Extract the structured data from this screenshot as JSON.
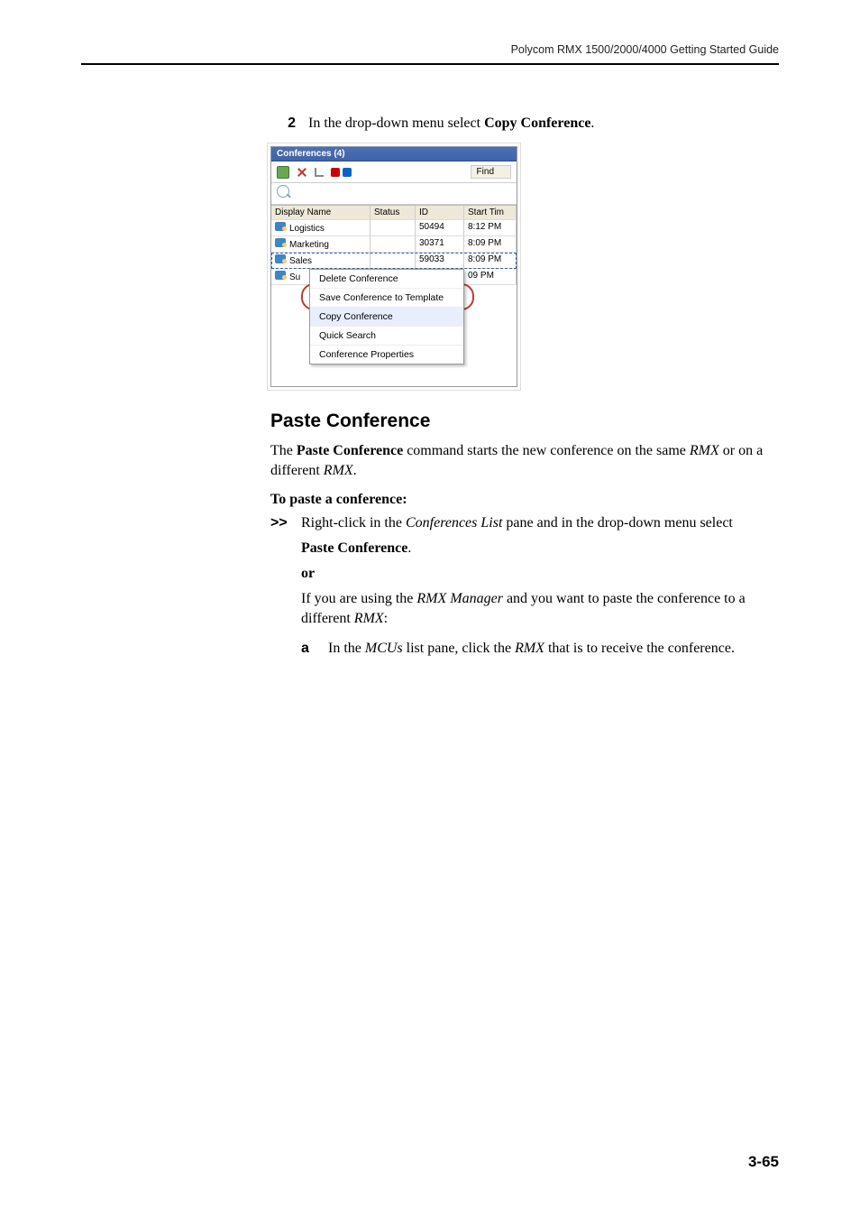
{
  "running_head": "Polycom RMX 1500/2000/4000 Getting Started Guide",
  "step2": {
    "num": "2",
    "text_pre": "In the drop-down menu select ",
    "text_bold": "Copy Conference",
    "text_post": "."
  },
  "shot": {
    "title": "Conferences (4)",
    "find_label": "Find",
    "headers": {
      "name": "Display Name",
      "status": "Status",
      "id": "ID",
      "start": "Start Tim"
    },
    "rows": [
      {
        "name": "Logistics",
        "id": "50494",
        "start": "8:12 PM"
      },
      {
        "name": "Marketing",
        "id": "30371",
        "start": "8:09 PM"
      },
      {
        "name": "Sales",
        "id": "59033",
        "start": "8:09 PM"
      },
      {
        "name": "Su",
        "id": "",
        "start": "09 PM"
      }
    ],
    "menu": {
      "delete": "Delete Conference",
      "save_tpl": "Save Conference to Template",
      "copy": "Copy Conference",
      "quick": "Quick Search",
      "props": "Conference Properties"
    }
  },
  "section_title": "Paste Conference",
  "para1": {
    "pre": "The ",
    "b1": "Paste Conference",
    "mid": " command starts the new conference on the same ",
    "i1": "RMX",
    "mid2": " or on a different ",
    "i2": "RMX",
    "post": "."
  },
  "subhead": "To paste a conference:",
  "angle_step": {
    "chev": ">>",
    "pre": "Right-click in the ",
    "i1": "Conferences List",
    "mid": " pane and in the drop-down menu select",
    "b1": "Paste Conference",
    "post": ".",
    "or": "or",
    "rmx_mgr_pre": "If you are using the ",
    "rmx_mgr_i": "RMX Manager",
    "rmx_mgr_mid": " and you want to paste the conference to a different ",
    "rmx_mgr_i2": "RMX",
    "rmx_mgr_post": ":"
  },
  "sub_a": {
    "let": "a",
    "pre": "In the ",
    "i1": "MCUs",
    "mid": " list pane, click the ",
    "i2": "RMX",
    "post": " that is to receive the conference."
  },
  "page_number": "3-65"
}
